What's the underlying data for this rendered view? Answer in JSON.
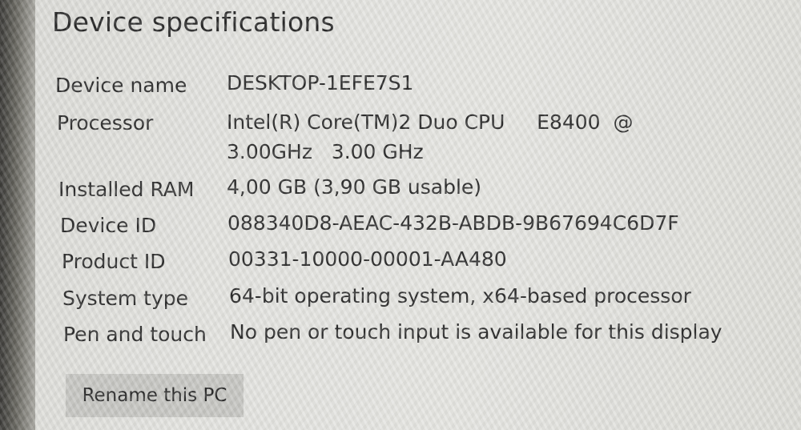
{
  "section_title": "Device specifications",
  "specs": [
    {
      "label": "Device name",
      "value": "DESKTOP-1EFE7S1"
    },
    {
      "label": "Processor",
      "value": "Intel(R) Core(TM)2 Duo CPU     E8400  @\n3.00GHz   3.00 GHz"
    },
    {
      "label": "Installed RAM",
      "value": "4,00 GB (3,90 GB usable)"
    },
    {
      "label": "Device ID",
      "value": "088340D8-AEAC-432B-ABDB-9B67694C6D7F"
    },
    {
      "label": "Product ID",
      "value": "00331-10000-00001-AA480"
    },
    {
      "label": "System type",
      "value": "64-bit operating system, x64-based processor"
    },
    {
      "label": "Pen and touch",
      "value": "No pen or touch input is available for this display"
    }
  ],
  "rename_button_label": "Rename this PC"
}
